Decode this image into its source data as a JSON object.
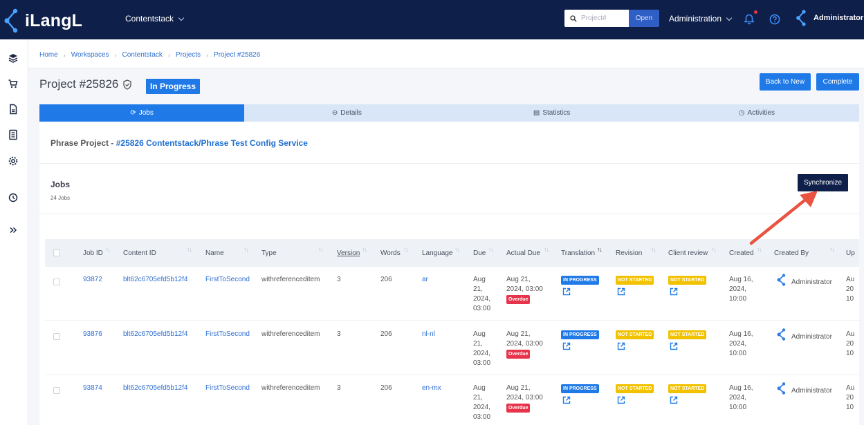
{
  "header": {
    "logo_text": "iLangL",
    "workspace": "Contentstack",
    "search_placeholder": "Project#",
    "open_label": "Open",
    "admin_menu": "Administration",
    "user_name": "Administrator"
  },
  "breadcrumb": [
    "Home",
    "Workspaces",
    "Contentstack",
    "Projects",
    "Project #25826"
  ],
  "project": {
    "title": "Project #25826",
    "status": "In Progress",
    "back_button": "Back to New",
    "complete_button": "Complete"
  },
  "tabs": [
    {
      "label": "Jobs",
      "icon": "refresh-icon"
    },
    {
      "label": "Details",
      "icon": "info-icon"
    },
    {
      "label": "Statistics",
      "icon": "chart-icon"
    },
    {
      "label": "Activities",
      "icon": "history-icon"
    }
  ],
  "phrase": {
    "prefix": "Phrase Project - ",
    "link": "#25826 Contentstack/Phrase Test Config Service"
  },
  "jobs": {
    "title": "Jobs",
    "count": "24 Jobs",
    "sync_button": "Synchronize"
  },
  "columns": [
    "Job ID",
    "Content ID",
    "Name",
    "Type",
    "Version",
    "Words",
    "Language",
    "Due",
    "Actual Due",
    "Translation",
    "Revision",
    "Client review",
    "Created",
    "Created By",
    "Up"
  ],
  "rows": [
    {
      "job_id": "93872",
      "content_id": "blt62c6705efd5b12f4",
      "name": "FirstToSecond",
      "type": "withreferenceditem",
      "version": "3",
      "words": "206",
      "language": "ar",
      "due": [
        "Aug",
        "21,",
        "2024,",
        "03:00"
      ],
      "actual_due": [
        "Aug 21,",
        "2024, 03:00"
      ],
      "overdue": "Overdue",
      "translation": "IN PROGRESS",
      "revision": "NOT STARTED",
      "client_review": "NOT STARTED",
      "created": [
        "Aug 16,",
        "2024,",
        "10:00"
      ],
      "created_by": "Administrator",
      "updated": [
        "Au",
        "20",
        "10"
      ]
    },
    {
      "job_id": "93876",
      "content_id": "blt62c6705efd5b12f4",
      "name": "FirstToSecond",
      "type": "withreferenceditem",
      "version": "3",
      "words": "206",
      "language": "nl-nl",
      "due": [
        "Aug",
        "21,",
        "2024,",
        "03:00"
      ],
      "actual_due": [
        "Aug 21,",
        "2024, 03:00"
      ],
      "overdue": "Overdue",
      "translation": "IN PROGRESS",
      "revision": "NOT STARTED",
      "client_review": "NOT STARTED",
      "created": [
        "Aug 16,",
        "2024,",
        "10:00"
      ],
      "created_by": "Administrator",
      "updated": [
        "Au",
        "20",
        "10"
      ]
    },
    {
      "job_id": "93874",
      "content_id": "blt62c6705efd5b12f4",
      "name": "FirstToSecond",
      "type": "withreferenceditem",
      "version": "3",
      "words": "206",
      "language": "en-mx",
      "due": [
        "Aug",
        "21,",
        "2024,",
        "03:00"
      ],
      "actual_due": [
        "Aug 21,",
        "2024, 03:00"
      ],
      "overdue": "Overdue",
      "translation": "IN PROGRESS",
      "revision": "NOT STARTED",
      "client_review": "NOT STARTED",
      "created": [
        "Aug 16,",
        "2024,",
        "10:00"
      ],
      "created_by": "Administrator",
      "updated": [
        "Au",
        "20",
        "10"
      ]
    }
  ],
  "colors": {
    "navy": "#0e1f4a",
    "blue": "#1f7ae8",
    "yellow": "#f2c200",
    "red": "#e8344a",
    "arrow": "#e9533f"
  }
}
